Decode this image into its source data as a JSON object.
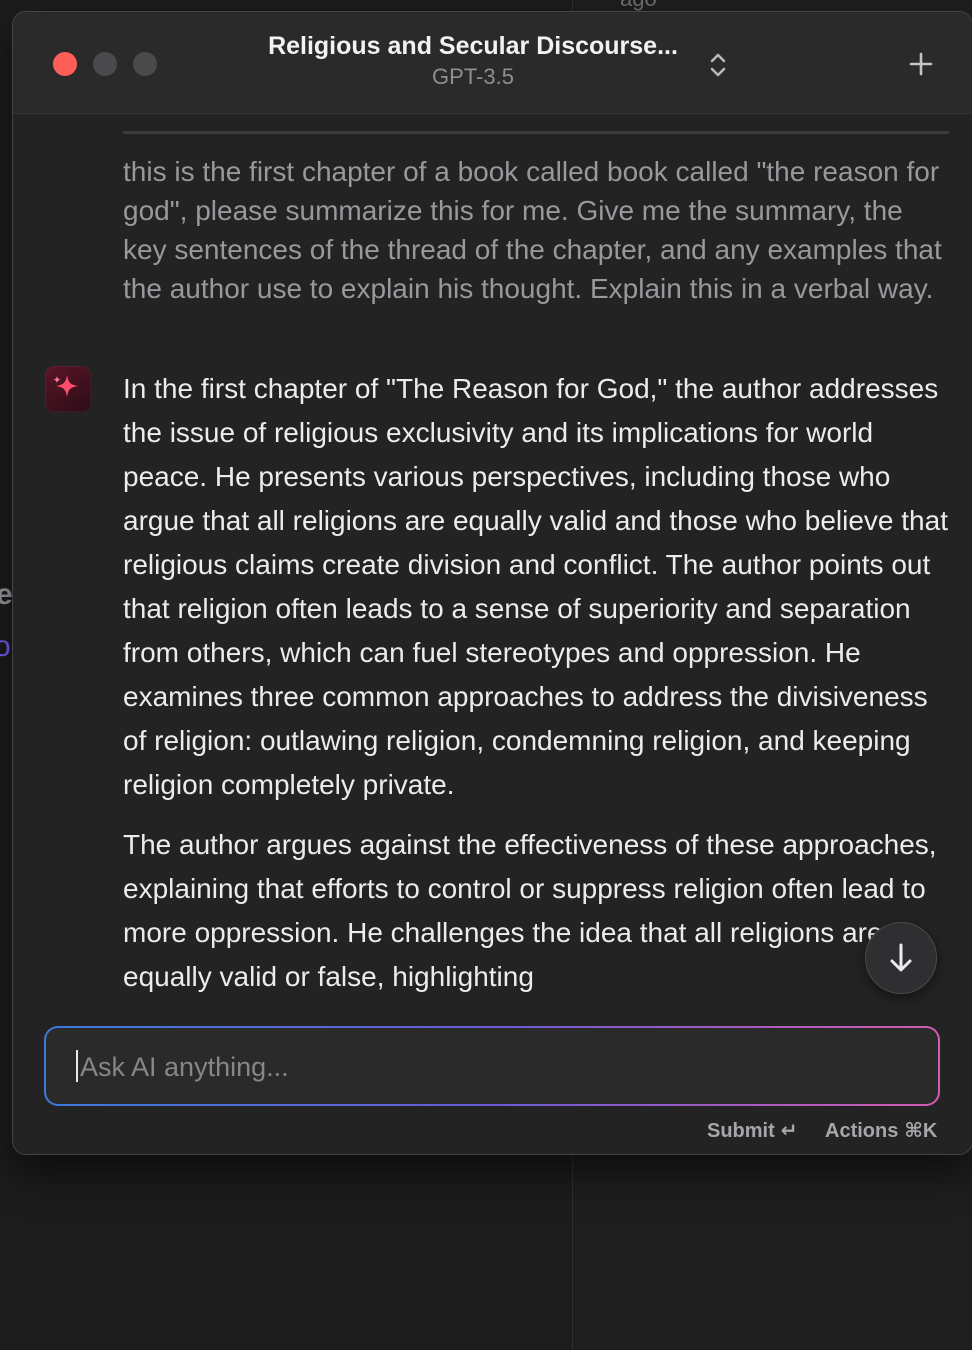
{
  "background": {
    "peek_top": "ago",
    "peek_left_1": "e",
    "peek_left_2": "o"
  },
  "window": {
    "title": "Religious and Secular Discourse...",
    "model": "GPT-3.5"
  },
  "icons": {
    "close": "close-button",
    "minimize": "minimize-button",
    "maximize": "maximize-button",
    "selector": "chevron-up-down-icon",
    "new_chat": "plus-icon",
    "assistant": "sparkle-icon",
    "scroll_down": "arrow-down-icon"
  },
  "colors": {
    "close": "#ff5f57",
    "avatar": "#5a1628",
    "sparkle": "#ff4d6d",
    "input_gradient_start": "#3d7bd9",
    "input_gradient_end": "#d35bb0"
  },
  "messages": {
    "user": "this is the first chapter of a book called book called \"the reason for god\", please summarize this for me. Give me the summary, the key sentences of the thread of the chapter, and any examples that the author use to explain his thought. Explain this in a verbal way.",
    "assistant": [
      "In the first chapter of \"The Reason for God,\" the author addresses the issue of religious exclusivity and its implications for world peace. He presents various perspectives, including those who argue that all religions are equally valid and those who believe that religious claims create division and conflict. The author points out that religion often leads to a sense of superiority and separation from others, which can fuel stereotypes and oppression. He examines three common approaches to address the divisiveness of religion: outlawing religion, condemning religion, and keeping religion completely private.",
      "The author argues against the effectiveness of these approaches, explaining that efforts to control or suppress religion often lead to more oppression. He challenges the idea that all religions are equally valid or false, highlighting"
    ]
  },
  "input": {
    "placeholder": "Ask AI anything...",
    "value": ""
  },
  "footer": {
    "submit_label": "Submit",
    "submit_key": "↵",
    "actions_label": "Actions",
    "actions_key": "⌘K"
  }
}
